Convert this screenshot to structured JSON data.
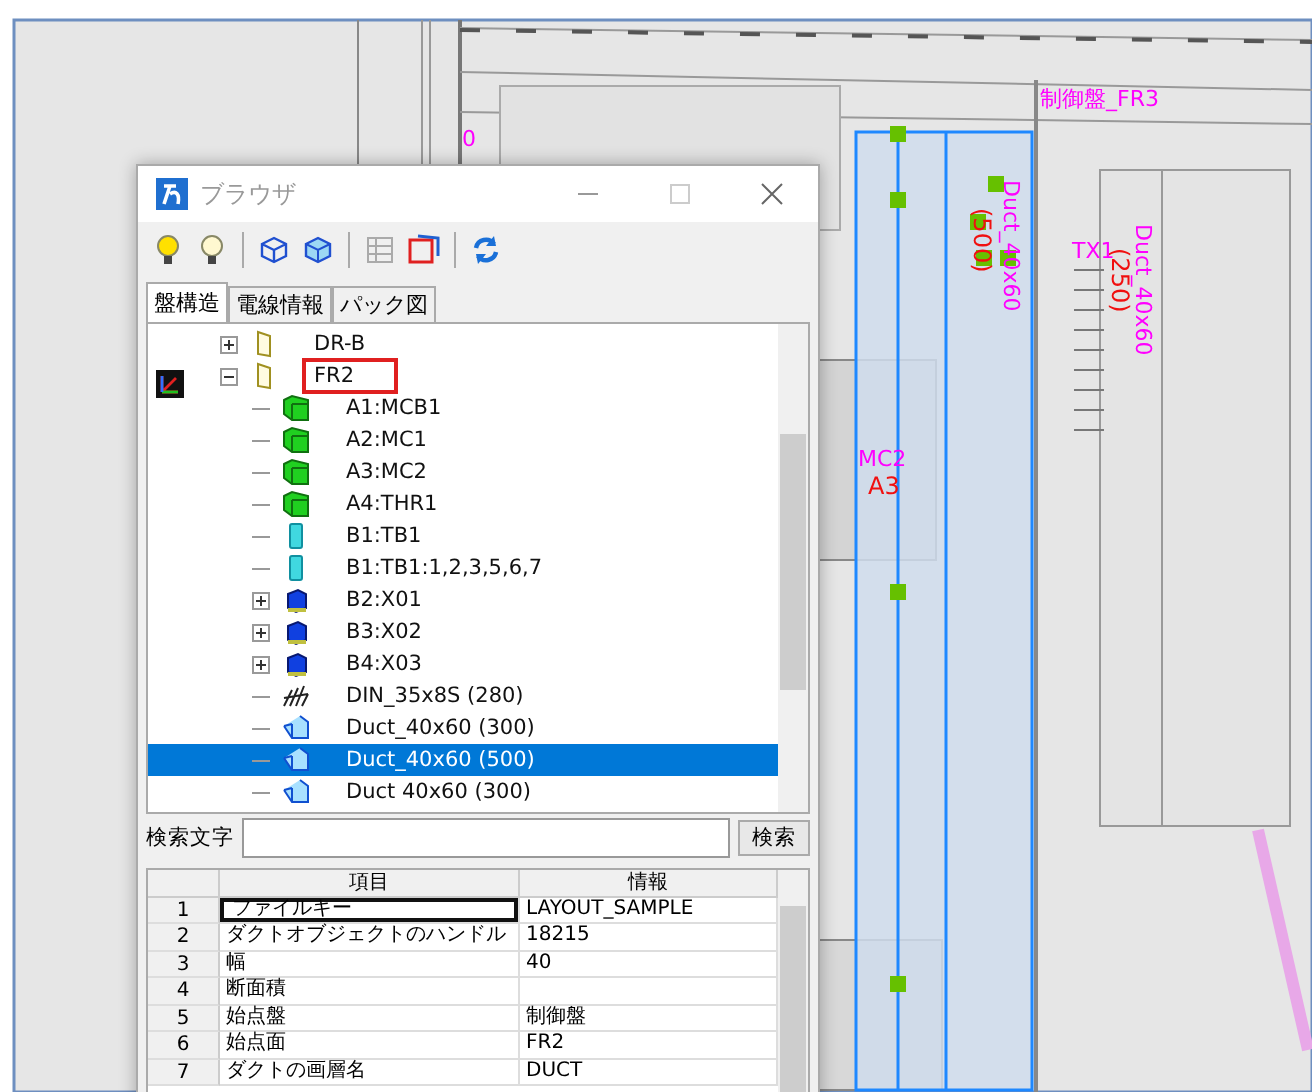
{
  "canvas": {
    "labels": [
      {
        "text": "0",
        "kind": "magenta"
      },
      {
        "text": "制御盤_FR3",
        "kind": "magenta"
      },
      {
        "text": "Duct_40x60",
        "kind": "magenta-vertical"
      },
      {
        "text": "(500)",
        "kind": "red-vertical"
      },
      {
        "text": "Duct_40x60",
        "kind": "magenta-vertical"
      },
      {
        "text": "(250)",
        "kind": "red-vertical"
      },
      {
        "text": "TX1",
        "kind": "magenta"
      },
      {
        "text": "MC2",
        "kind": "magenta"
      },
      {
        "text": "A3",
        "kind": "red"
      }
    ]
  },
  "window": {
    "title": "ブラウザ"
  },
  "tabs": [
    {
      "label": "盤構造",
      "selected": true
    },
    {
      "label": "電線情報",
      "selected": false
    },
    {
      "label": "パック図",
      "selected": false
    }
  ],
  "tree": [
    {
      "label": "DR-B",
      "kind": "panel",
      "expanded": false,
      "selected": false,
      "highlighted": false
    },
    {
      "label": "FR2",
      "kind": "panel",
      "expanded": true,
      "selected": false,
      "highlighted": true,
      "children": [
        {
          "label": "A1:MCB1",
          "kind": "device",
          "selected": false,
          "highlighted": false
        },
        {
          "label": "A2:MC1",
          "kind": "device",
          "selected": false,
          "highlighted": false
        },
        {
          "label": "A3:MC2",
          "kind": "device",
          "selected": false,
          "highlighted": false
        },
        {
          "label": "A4:THR1",
          "kind": "device",
          "selected": false,
          "highlighted": false
        },
        {
          "label": "B1:TB1",
          "kind": "terminal",
          "selected": false,
          "highlighted": false
        },
        {
          "label": "B1:TB1:1,2,3,5,6,7",
          "kind": "terminal",
          "selected": false,
          "highlighted": false
        },
        {
          "label": "B2:X01",
          "kind": "relay",
          "expanded": false,
          "selected": false,
          "highlighted": false
        },
        {
          "label": "B3:X02",
          "kind": "relay",
          "expanded": false,
          "selected": false,
          "highlighted": false
        },
        {
          "label": "B4:X03",
          "kind": "relay",
          "expanded": false,
          "selected": false,
          "highlighted": false
        },
        {
          "label": "DIN_35x8S (280)",
          "kind": "rail",
          "selected": false,
          "highlighted": false
        },
        {
          "label": "Duct_40x60 (300)",
          "kind": "duct",
          "selected": false,
          "highlighted": false
        },
        {
          "label": "Duct_40x60 (500)",
          "kind": "duct",
          "selected": true,
          "highlighted": false
        },
        {
          "label": "Duct 40x60 (300)",
          "kind": "duct",
          "selected": false,
          "highlighted": false
        }
      ]
    }
  ],
  "search": {
    "label": "検索文字",
    "button": "検索"
  },
  "table": {
    "columns": [
      "項目",
      "情報"
    ],
    "rows": [
      {
        "index": "1",
        "item": "ファイルキー",
        "value": "LAYOUT_SAMPLE",
        "selected": true
      },
      {
        "index": "2",
        "item": "ダクトオブジェクトのハンドル",
        "value": "18215",
        "selected": false
      },
      {
        "index": "3",
        "item": "幅",
        "value": "40",
        "selected": false
      },
      {
        "index": "4",
        "item": "断面積",
        "selected": false
      },
      {
        "index": "5",
        "item": "始点盤",
        "value": "制御盤",
        "selected": false
      },
      {
        "index": "6",
        "item": "始点面",
        "value": "FR2",
        "selected": false
      },
      {
        "index": "7",
        "item": "ダクトの画層名",
        "value": "DUCT",
        "selected": false
      }
    ]
  }
}
